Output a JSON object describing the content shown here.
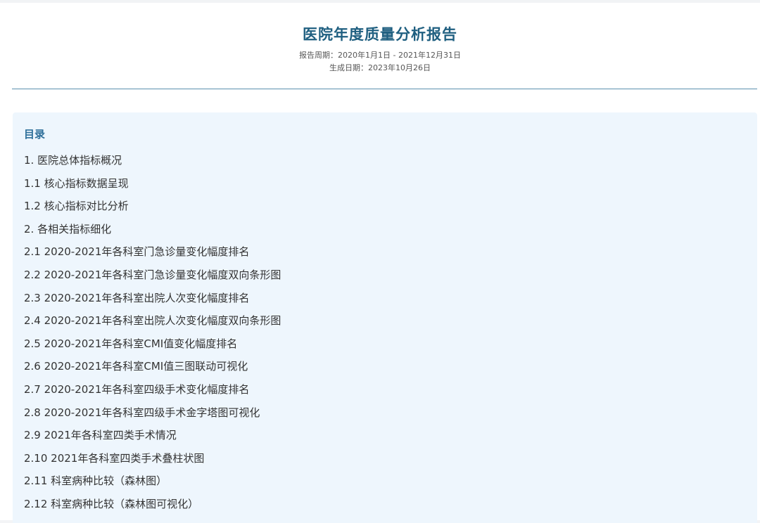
{
  "report": {
    "title": "医院年度质量分析报告",
    "period": "报告周期：2020年1月1日 - 2021年12月31日",
    "generated": "生成日期：2023年10月26日"
  },
  "toc": {
    "title": "目录",
    "items": [
      "1. 医院总体指标概况",
      "1.1 核心指标数据呈现",
      "1.2 核心指标对比分析",
      "2. 各相关指标细化",
      "2.1 2020-2021年各科室门急诊量变化幅度排名",
      "2.2 2020-2021年各科室门急诊量变化幅度双向条形图",
      "2.3 2020-2021年各科室出院人次变化幅度排名",
      "2.4 2020-2021年各科室出院人次变化幅度双向条形图",
      "2.5 2020-2021年各科室CMI值变化幅度排名",
      "2.6 2020-2021年各科室CMI值三图联动可视化",
      "2.7 2020-2021年各科室四级手术变化幅度排名",
      "2.8 2020-2021年各科室四级手术金字塔图可视化",
      "2.9 2021年各科室四类手术情况",
      "2.10 2021年各科室四类手术叠柱状图",
      "2.11 科室病种比较（森林图）",
      "2.12 科室病种比较（森林图可视化）"
    ]
  },
  "colors": {
    "title": "#1f5f80",
    "toc_heading": "#2e6f9a",
    "toc_background": "#eef6fd",
    "divider": "#5b8fae"
  }
}
